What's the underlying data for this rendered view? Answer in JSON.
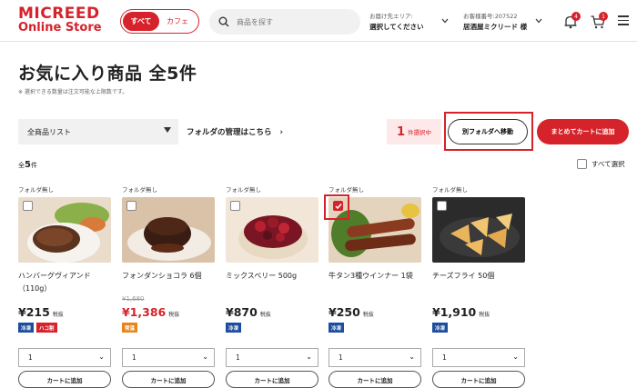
{
  "header": {
    "logo_line1": "MICREED",
    "logo_line2": "Online Store",
    "seg_all": "すべて",
    "seg_cafe": "カフェ",
    "search_placeholder": "商品を探す",
    "delivery_label": "お届け先エリア:",
    "delivery_value": "選択してください",
    "customer_label": "お客様番号:207522",
    "customer_name": "居酒屋ミクリード 様",
    "notification_count": "4",
    "cart_count": "1"
  },
  "page": {
    "title": "お気に入り商品 全5件",
    "note": "※ 選択できる数量は注文可能な上限数です。",
    "list_select": "全商品リスト",
    "folder_manage": "フォルダの管理はこちら",
    "selected_count": "1",
    "selected_label": "件選択中",
    "move_folder": "別フォルダへ移動",
    "add_all_to_cart": "まとめてカートに追加",
    "total_prefix": "全",
    "total_count": "5",
    "total_suffix": "件",
    "select_all": "すべて選択"
  },
  "products": [
    {
      "folder": "フォルダ無し",
      "name": "ハンバーグヴィアンド（110g）",
      "old_price": "",
      "price": "¥215",
      "tax": "税抜",
      "tags": [
        {
          "label": "冷凍",
          "color": "blue"
        },
        {
          "label": "ハコ割",
          "color": "red"
        }
      ],
      "qty": "1",
      "button": "カートに追加",
      "checked": false,
      "price_red": false
    },
    {
      "folder": "フォルダ無し",
      "name": "フォンダンショコラ 6個",
      "old_price": "¥1,680",
      "price": "¥1,386",
      "tax": "税抜",
      "tags": [
        {
          "label": "常温",
          "color": "orange"
        }
      ],
      "qty": "1",
      "button": "カートに追加",
      "checked": false,
      "price_red": true
    },
    {
      "folder": "フォルダ無し",
      "name": "ミックスベリー 500g",
      "old_price": "",
      "price": "¥870",
      "tax": "税抜",
      "tags": [
        {
          "label": "冷凍",
          "color": "blue"
        }
      ],
      "qty": "1",
      "button": "カートに追加",
      "checked": false,
      "price_red": false
    },
    {
      "folder": "フォルダ無し",
      "name": "牛タン3種ウインナー 1袋",
      "old_price": "",
      "price": "¥250",
      "tax": "税抜",
      "tags": [
        {
          "label": "冷凍",
          "color": "blue"
        }
      ],
      "qty": "1",
      "button": "カートに追加",
      "checked": true,
      "price_red": false
    },
    {
      "folder": "フォルダ無し",
      "name": "チーズフライ 50個",
      "old_price": "",
      "price": "¥1,910",
      "tax": "税抜",
      "tags": [
        {
          "label": "冷凍",
          "color": "blue"
        }
      ],
      "qty": "1",
      "button": "カートに追加",
      "checked": false,
      "price_red": false
    }
  ],
  "colors": {
    "accent": "#d6222a",
    "frozen": "#1d4e9e",
    "ambient": "#e8841c"
  }
}
